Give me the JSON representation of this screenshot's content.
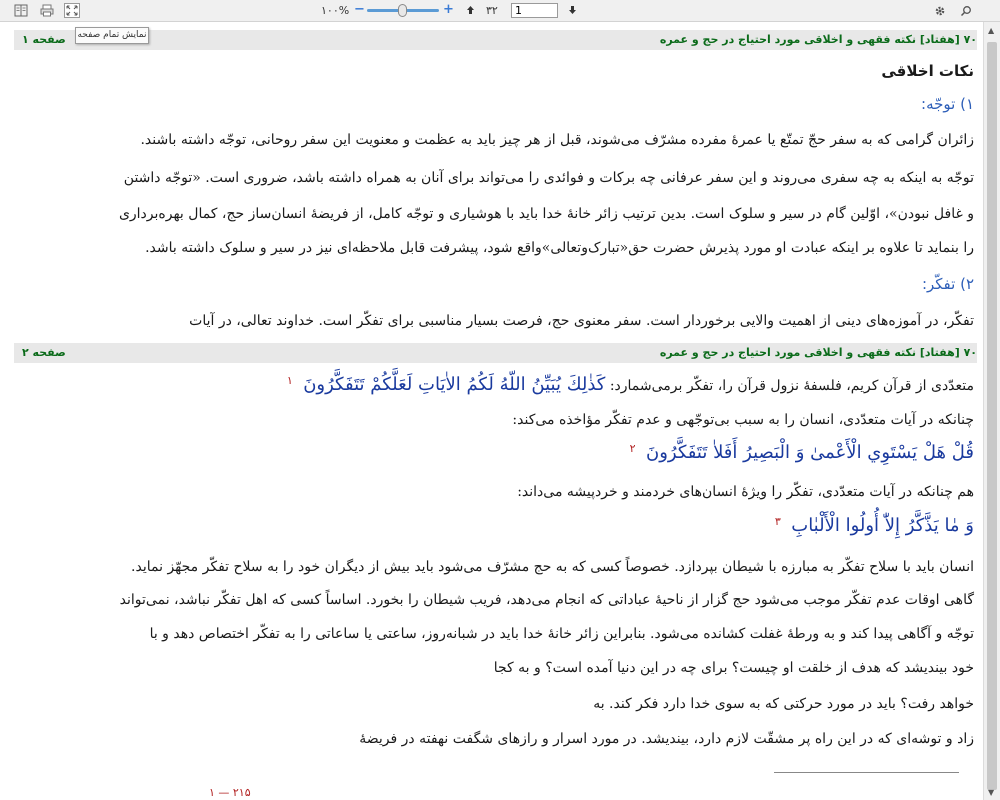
{
  "toolbar": {
    "zoom_label": "۱۰۰%",
    "zoom_level_percent": 100,
    "page_total": "۳۲",
    "page_current": "1",
    "zoom_minus": "−",
    "zoom_plus": "+",
    "icons": [
      "book-icon",
      "print-icon",
      "fullscreen-icon",
      "settings-icon",
      "search-icon",
      "arrow-up-icon",
      "arrow-down-icon"
    ]
  },
  "tooltip": {
    "text": "نمایش تمام صفحه"
  },
  "page1": {
    "header_title": "۷۰ [هفتاد] نکته فقهی و اخلاقی مورد احتیاج در حج و عمره",
    "header_page": "صفحه ۱",
    "heading": "نکات اخلاقی",
    "sub1": "۱) توجّه:",
    "para1": [
      "زائران گرامی که به سفر حجّ تمتّع یا عمرۀ مفرده مشرّف می‌شوند، قبل از هر چیز باید به عظمت و معنویت این سفر روحانی، توجّه داشته باشند.",
      "توجّه به اینکه به چه سفری می‌روند و این سفر عرفانی چه برکات و فوائدی را می‌تواند برای آنان به همراه داشته باشد، ضروری است. «توجّه داشتن",
      "و غافل نبودن»، اوّلین گام در سیر و سلوک است. بدین ترتیب زائر خانۀ خدا باید با هوشیاری و توجّه کامل، از فریضۀ انسان‌ساز حج، کمال بهره‌برداری",
      "را بنماید تا علاوه بر اینکه عبادت او مورد پذیرش حضرت حق«تبارک‌وتعالی»واقع شود، پیشرفت قابل ملاحظه‌ای نیز در سیر و سلوک داشته باشد."
    ],
    "sub2": "۲) تفکّر:",
    "para2": "تفکّر، در آموزه‌های دینی از اهمیت والایی برخوردار است. سفر معنوی حج، فرصت بسیار مناسبی برای تفکّر است. خداوند تعالی، در آیات"
  },
  "page2": {
    "header_title": "۷۰ [هفتاد] نکته فقهی و اخلاقی مورد احتیاج در حج و عمره",
    "header_page": "صفحه ۲",
    "line1": "متعدّدی از قرآن کریم، فلسفۀ نزول قرآن را، تفکّر برمی‌شمارد:",
    "verse1": "كَذٰلِكَ يُبَيِّنُ اللّهُ لَكُمُ الاٰيَاتِ لَعَلَّكُمْ تَتَفَكَّرُونَ",
    "fn1": "۱",
    "line2": "چنانکه در آیات متعدّدی، انسان را به سبب بی‌توجّهی و عدم تفکّر مؤاخذه می‌کند:",
    "verse2": "قُلْ هَلْ يَسْتَوِي الْأَعْمىٰ وَ الْبَصِيرُ أَفَلاٰ تَتَفَكَّرُونَ",
    "fn2": "۲",
    "line3": "هم چنانکه در آیات متعدّدی، تفکّر را ویژۀ انسان‌های خردمند و خردپیشه می‌داند:",
    "verse3": "وَ مٰا يَذَّكَّرُ إِلاّٰ أُولُوا الْأَلْبٰابِ",
    "fn3": "۳",
    "para": [
      "انسان باید با سلاح تفکّر به مبارزه با شیطان بپردازد. خصوصاً کسی که به حج مشرّف می‌شود باید بیش از دیگران خود را به سلاح تفکّر مجهّز نماید.",
      "گاهی اوقات عدم تفکّر موجب می‌شود حج گزار از ناحیۀ عباداتی که انجام می‌دهد، فریب شیطان را بخورد. اساساً کسی که اهل تفکّر نباشد، نمی‌تواند",
      "توجّه و آگاهی پیدا کند و به ورطۀ غفلت کشانده می‌شود. بنابراین زائر خانۀ خدا باید در شبانه‌روز، ساعتی یا ساعاتی را به تفکّر اختصاص دهد و با",
      "خود بیندیشد که هدف از خلقت او چیست؟ برای چه در این دنیا آمده است؟ و به کجا",
      "خواهد رفت؟ باید در مورد حرکتی که به سوی خدا دارد فکر کند. به",
      "زاد و توشه‌ای که در این راه پر مشقّت لازم دارد، بیندیشد. در مورد اسرار و رازهای شگفت نهفته در فریضۀ"
    ],
    "page_number": "۱ — ۲۱۵"
  },
  "colors": {
    "header_text": "#0b6b1a",
    "verse": "#1a3a9e",
    "subheading": "#2e5fb8",
    "footnote": "#b22222"
  }
}
